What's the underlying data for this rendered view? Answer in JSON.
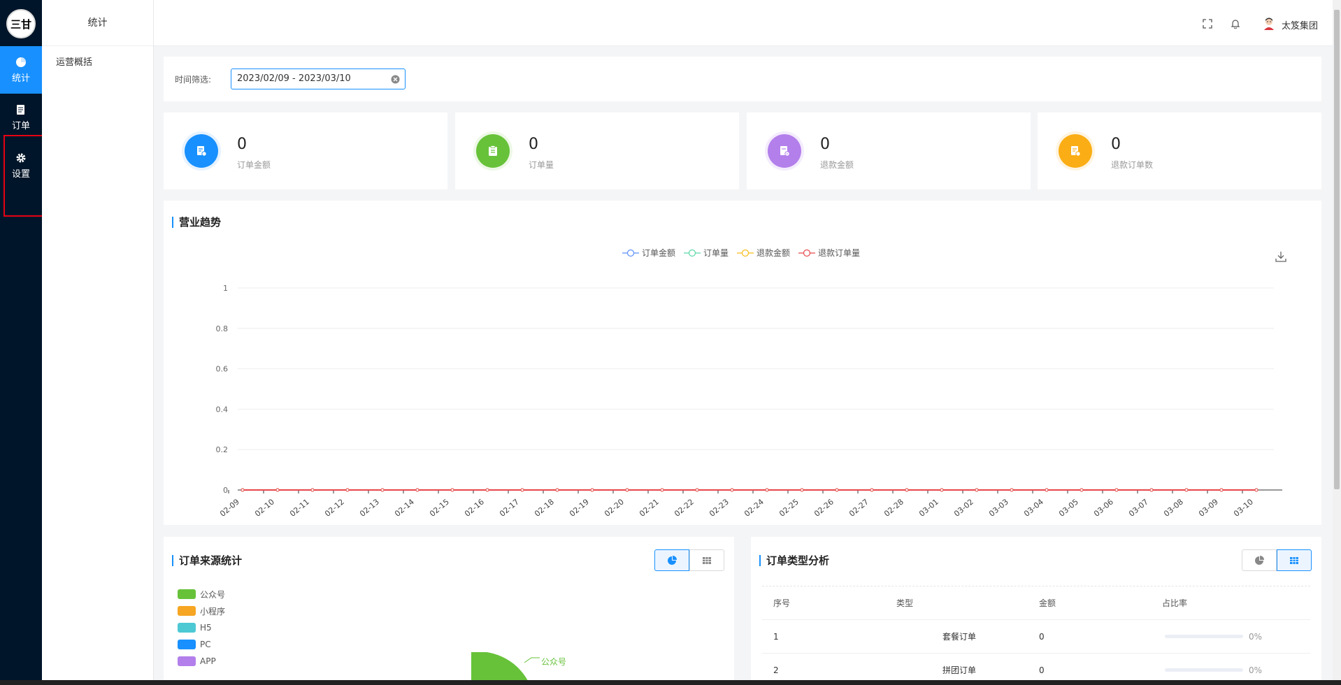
{
  "rail": {
    "logo_text": "三甘",
    "items": [
      {
        "label": "统计",
        "icon": "chart-icon",
        "active": true
      },
      {
        "label": "订单",
        "icon": "order-icon",
        "active": false
      },
      {
        "label": "设置",
        "icon": "gear-icon",
        "active": false
      }
    ]
  },
  "submenu": {
    "title": "统计",
    "items": [
      "运营概括"
    ]
  },
  "topbar": {
    "user_name": "太笈集团",
    "icons": [
      "fullscreen-icon",
      "bell-icon"
    ]
  },
  "filter": {
    "label": "时间筛选:",
    "value": "2023/02/09 - 2023/03/10"
  },
  "stats": [
    {
      "value": "0",
      "label": "订单金额",
      "color": "#1890ff"
    },
    {
      "value": "0",
      "label": "订单量",
      "color": "#67c23a"
    },
    {
      "value": "0",
      "label": "退款金额",
      "color": "#b37feb"
    },
    {
      "value": "0",
      "label": "退款订单数",
      "color": "#faad14"
    }
  ],
  "trend": {
    "title": "营业趋势"
  },
  "chart_data": {
    "type": "line",
    "title": "营业趋势",
    "x": [
      "02-09",
      "02-10",
      "02-11",
      "02-12",
      "02-13",
      "02-14",
      "02-15",
      "02-16",
      "02-17",
      "02-18",
      "02-19",
      "02-20",
      "02-21",
      "02-22",
      "02-23",
      "02-24",
      "02-25",
      "02-26",
      "02-27",
      "02-28",
      "03-01",
      "03-02",
      "03-03",
      "03-04",
      "03-05",
      "03-06",
      "03-07",
      "03-08",
      "03-09",
      "03-10"
    ],
    "yticks": [
      "0",
      "0.2",
      "0.4",
      "0.6",
      "0.8",
      "1"
    ],
    "ylim": [
      0,
      1
    ],
    "series": [
      {
        "name": "订单金额",
        "color": "#5b8ff9",
        "values": [
          0,
          0,
          0,
          0,
          0,
          0,
          0,
          0,
          0,
          0,
          0,
          0,
          0,
          0,
          0,
          0,
          0,
          0,
          0,
          0,
          0,
          0,
          0,
          0,
          0,
          0,
          0,
          0,
          0,
          0
        ]
      },
      {
        "name": "订单量",
        "color": "#5ad8a6",
        "values": [
          0,
          0,
          0,
          0,
          0,
          0,
          0,
          0,
          0,
          0,
          0,
          0,
          0,
          0,
          0,
          0,
          0,
          0,
          0,
          0,
          0,
          0,
          0,
          0,
          0,
          0,
          0,
          0,
          0,
          0
        ]
      },
      {
        "name": "退款金额",
        "color": "#f6bd16",
        "values": [
          0,
          0,
          0,
          0,
          0,
          0,
          0,
          0,
          0,
          0,
          0,
          0,
          0,
          0,
          0,
          0,
          0,
          0,
          0,
          0,
          0,
          0,
          0,
          0,
          0,
          0,
          0,
          0,
          0,
          0
        ]
      },
      {
        "name": "退款订单量",
        "color": "#e8474c",
        "values": [
          0,
          0,
          0,
          0,
          0,
          0,
          0,
          0,
          0,
          0,
          0,
          0,
          0,
          0,
          0,
          0,
          0,
          0,
          0,
          0,
          0,
          0,
          0,
          0,
          0,
          0,
          0,
          0,
          0,
          0
        ]
      }
    ],
    "grid": true,
    "legend": "top-center"
  },
  "source": {
    "title": "订单来源统计",
    "legend": [
      {
        "name": "公众号",
        "color": "#67c23a"
      },
      {
        "name": "小程序",
        "color": "#f6a623"
      },
      {
        "name": "H5",
        "color": "#4dc9d4"
      },
      {
        "name": "PC",
        "color": "#1890ff"
      },
      {
        "name": "APP",
        "color": "#b37feb"
      }
    ],
    "pie_label": "公众号"
  },
  "type_analysis": {
    "title": "订单类型分析",
    "headers": [
      "序号",
      "类型",
      "金额",
      "占比率"
    ],
    "rows": [
      {
        "index": "1",
        "type": "套餐订单",
        "amount": "0",
        "ratio": "0%",
        "fill": 0
      },
      {
        "index": "2",
        "type": "拼团订单",
        "amount": "0",
        "ratio": "0%",
        "fill": 0
      }
    ]
  }
}
